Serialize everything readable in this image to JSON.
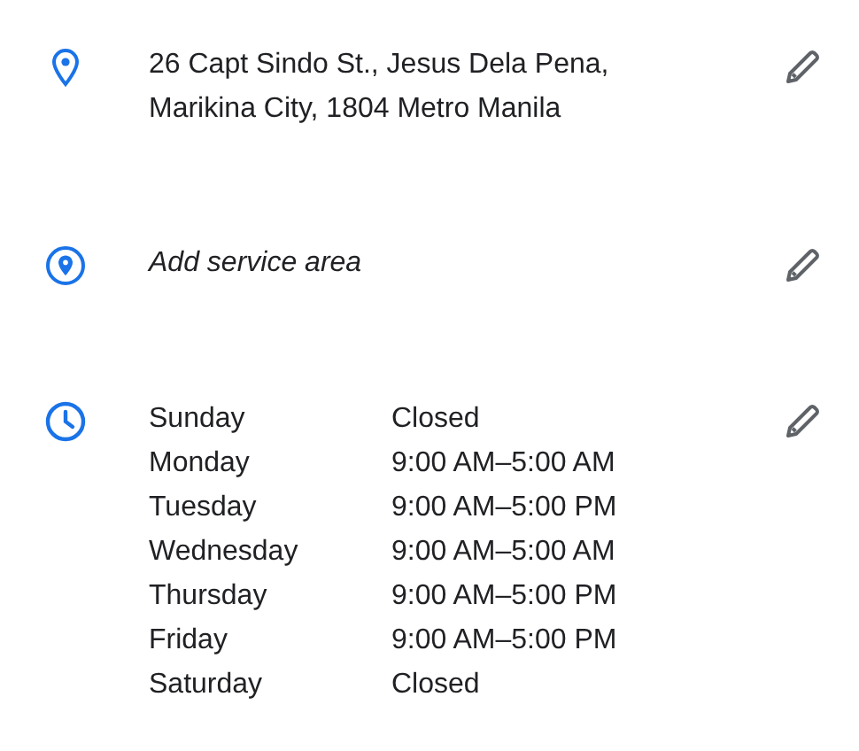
{
  "sections": [
    {
      "kind": "address",
      "lines": [
        "26 Capt Sindo St., Jesus Dela Pena,",
        "Marikina City, 1804 Metro Manila"
      ]
    },
    {
      "kind": "service_area",
      "placeholder": "Add service area"
    },
    {
      "kind": "hours",
      "days": [
        {
          "day": "Sunday",
          "hours": "Closed"
        },
        {
          "day": "Monday",
          "hours": "9:00 AM–5:00 AM"
        },
        {
          "day": "Tuesday",
          "hours": "9:00 AM–5:00 PM"
        },
        {
          "day": "Wednesday",
          "hours": "9:00 AM–5:00 AM"
        },
        {
          "day": "Thursday",
          "hours": "9:00 AM–5:00 PM"
        },
        {
          "day": "Friday",
          "hours": "9:00 AM–5:00 PM"
        },
        {
          "day": "Saturday",
          "hours": "Closed"
        }
      ]
    }
  ]
}
